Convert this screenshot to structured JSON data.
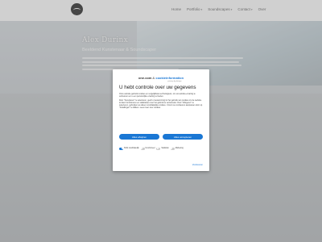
{
  "header": {
    "nav": [
      {
        "label": "Home",
        "chevron": false
      },
      {
        "label": "Portfolio",
        "chevron": true
      },
      {
        "label": "Soundscapes",
        "chevron": true
      },
      {
        "label": "Contact",
        "chevron": true
      },
      {
        "label": "Over",
        "chevron": false
      }
    ]
  },
  "hero": {
    "title": "Alex Durinx",
    "subtitle": "Beeldend Kunstenaar & Soundscaper"
  },
  "consent": {
    "brand_site": "one.com",
    "brand_amp": "&",
    "brand_mark": "cookieinformation",
    "brand_mark_sub": "privacy by design",
    "title": "U hebt controle over uw gegevens",
    "paragraphs": [
      "Onze website gebruikt cookies en vergelijkbare technologieën, om uw website-ervaring te verbeteren en u een persoonlijke ervaring te bieden.",
      "Door \"Accepteren\" te selecteren, geeft u toestemming tot het gebruik van cookies om de website te laten functioneren en statistieken over het gebruik te verzamelen. Door \"Weigeren\" te selecteren, gebruiken we alleen noodzakelijke cookies. U kunt uw voorkeuren aanpassen door op \"Instellingen\" te klikken. Lees meer over cookies."
    ],
    "reject_label": "Alles afwijzen",
    "accept_label": "Alles accepteren",
    "toggles": [
      {
        "label": "Strikt noodzakelijk",
        "on": true
      },
      {
        "label": "Functioneel",
        "on": false
      },
      {
        "label": "Statistiek",
        "on": false
      },
      {
        "label": "Marketing",
        "on": false
      }
    ],
    "preferences_link": "Voorkeuren"
  },
  "colors": {
    "accent": "#1a77d4"
  }
}
